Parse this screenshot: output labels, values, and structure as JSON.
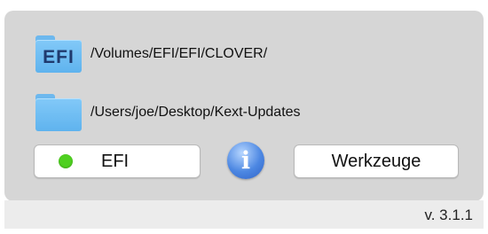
{
  "efi_path": {
    "icon_label": "EFI",
    "path": "/Volumes/EFI/EFI/CLOVER/"
  },
  "kext_path": {
    "path": "/Users/joe/Desktop/Kext-Updates"
  },
  "buttons": {
    "efi_label": "EFI",
    "efi_status_color": "#4fd020",
    "info_glyph": "i",
    "tools_label": "Werkzeuge"
  },
  "status": {
    "version": "v. 3.1.1"
  }
}
